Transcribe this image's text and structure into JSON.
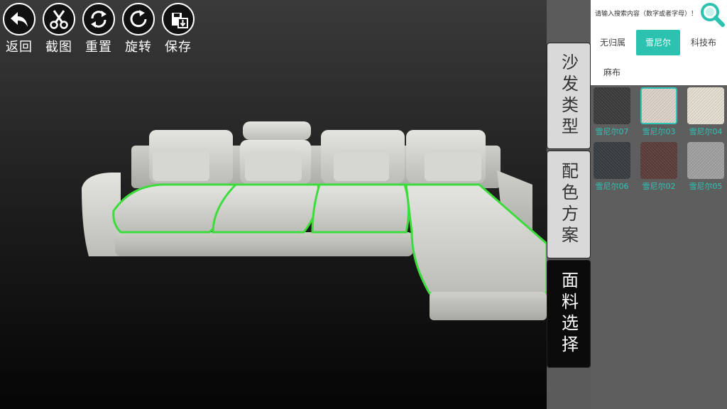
{
  "toolbar": {
    "back_label": "返回",
    "screenshot_label": "截图",
    "reset_label": "重置",
    "rotate_label": "旋转",
    "save_label": "保存"
  },
  "side_tabs": [
    {
      "label": "沙发类型",
      "active": false
    },
    {
      "label": "配色方案",
      "active": false
    },
    {
      "label": "面料选择",
      "active": true
    }
  ],
  "search": {
    "placeholder": "请输入搜索内容（数字或者字母）！",
    "icon": "magnifier-icon"
  },
  "categories": [
    {
      "label": "无归属",
      "active": false
    },
    {
      "label": "雪尼尔",
      "active": true
    },
    {
      "label": "科技布",
      "active": false
    },
    {
      "label": "麻布",
      "active": false
    }
  ],
  "fabrics": [
    {
      "name": "雪尼尔07",
      "color": "#3a3a3a",
      "selected": false
    },
    {
      "name": "雪尼尔03",
      "color": "#ddd4c9",
      "selected": true
    },
    {
      "name": "雪尼尔04",
      "color": "#e6dfd2",
      "selected": false
    },
    {
      "name": "雪尼尔06",
      "color": "#363b3d",
      "selected": false
    },
    {
      "name": "雪尼尔02",
      "color": "#5a3c38",
      "selected": false
    },
    {
      "name": "雪尼尔05",
      "color": "#a2a2a2",
      "selected": false
    }
  ],
  "colors": {
    "accent": "#2bc3b0",
    "selection_outline": "#3ddc3d",
    "sofa_fabric": "#d8d8d4"
  }
}
